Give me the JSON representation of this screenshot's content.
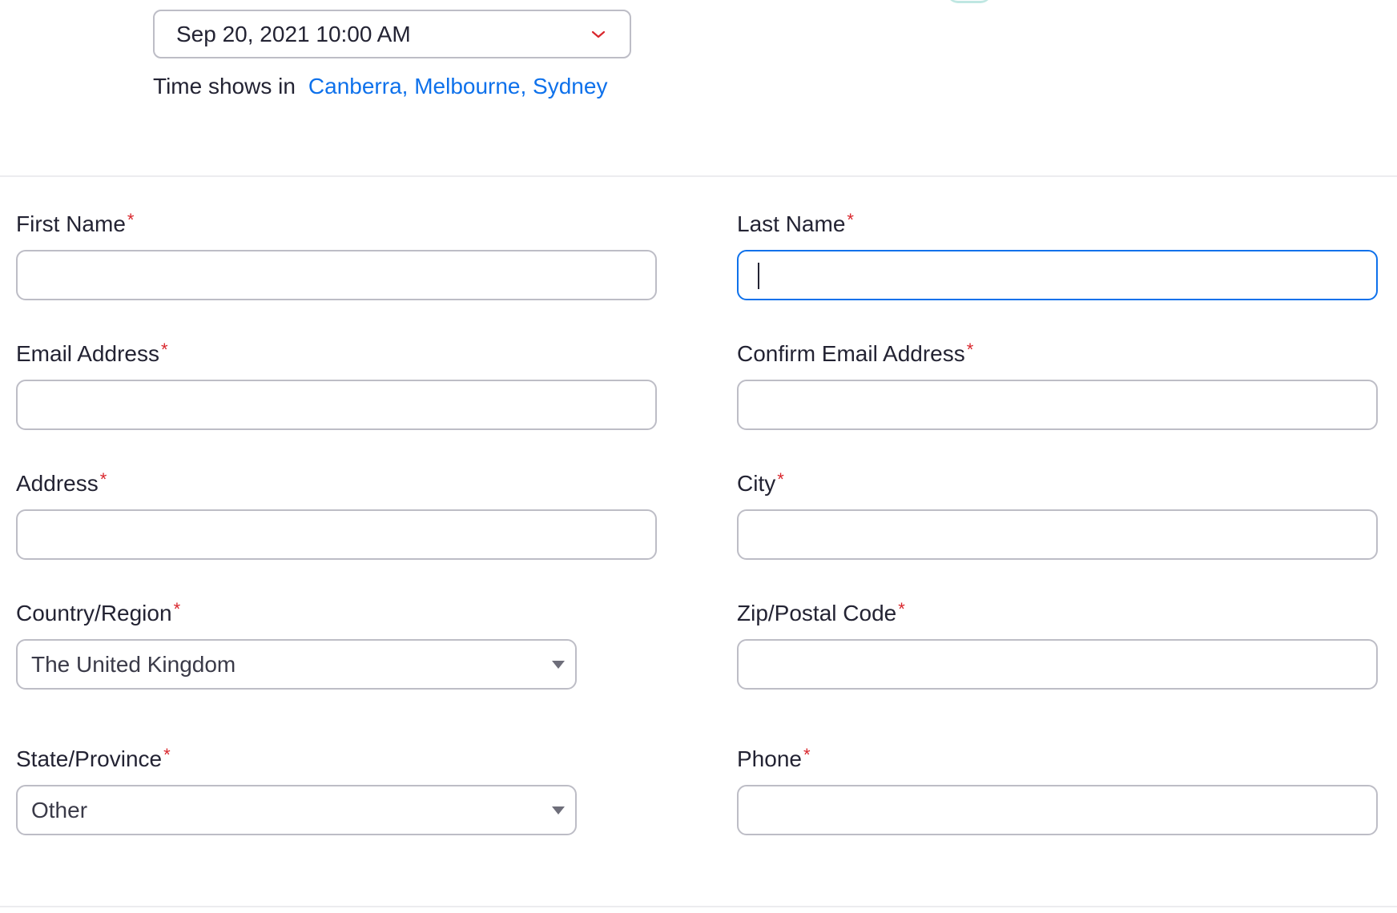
{
  "schedule": {
    "selected_datetime": "Sep 20, 2021 10:00 AM",
    "timezone_prefix": "Time shows in",
    "timezone_link": "Canberra, Melbourne, Sydney"
  },
  "form": {
    "required_marker": "*",
    "first_name": {
      "label": "First Name",
      "value": ""
    },
    "last_name": {
      "label": "Last Name",
      "value": ""
    },
    "email": {
      "label": "Email Address",
      "value": ""
    },
    "confirm_email": {
      "label": "Confirm Email Address",
      "value": ""
    },
    "address": {
      "label": "Address",
      "value": ""
    },
    "city": {
      "label": "City",
      "value": ""
    },
    "country": {
      "label": "Country/Region",
      "selected": "The United Kingdom"
    },
    "zip": {
      "label": "Zip/Postal Code",
      "value": ""
    },
    "state": {
      "label": "State/Province",
      "selected": "Other"
    },
    "phone": {
      "label": "Phone",
      "value": ""
    }
  },
  "colors": {
    "link": "#0e71eb",
    "required": "#d9262c",
    "focus_border": "#0e71eb",
    "input_border": "#bdbdc6"
  },
  "icons": {
    "datetime_dropdown": "chevron-down-icon",
    "select_dropdown": "triangle-down-icon"
  }
}
